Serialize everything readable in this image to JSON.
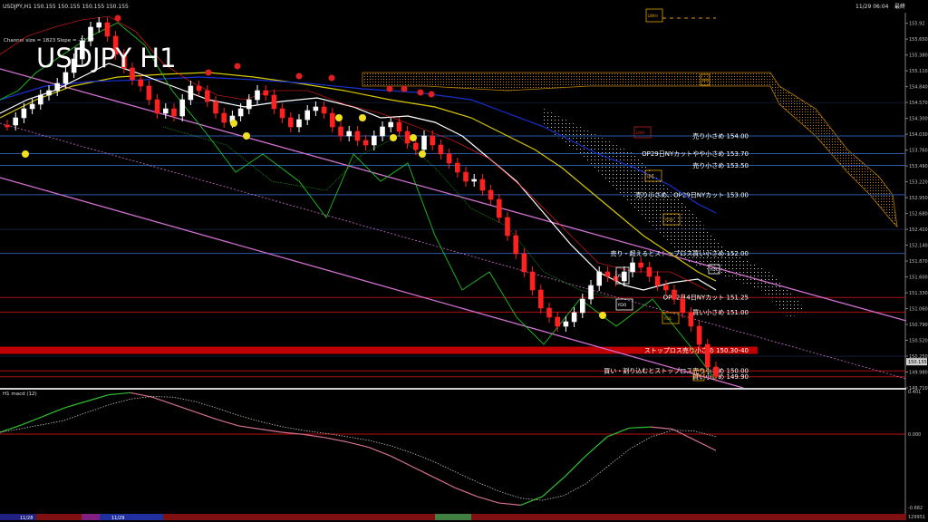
{
  "header": {
    "symbol_line": "USDJPY,H1  150.155 150.155 150.155 150.155",
    "datetime": "11/29 06:04",
    "label_extra": "最終",
    "channel_info": "Channel size = 1823 Slope = -11.27",
    "big_title": "USDJPY H1"
  },
  "macd": {
    "label": "H1  macd (12)",
    "top_value": "0.401",
    "bottom_value": "-0.682",
    "zero_value": "0.000",
    "bottom_corner": "129951"
  },
  "bottom_bar": {
    "date_1": "11/28",
    "date_2": "11/29"
  },
  "colors": {
    "bull": "#ffffff",
    "bear": "#ff2020",
    "kumo": "#c08000",
    "gridline": "#2a58a8",
    "redline": "#b01010",
    "channel": "#d070d0",
    "green": "#20c020",
    "ma_white": "#ffffff",
    "ma_yellow": "#d8c800",
    "ma_blue": "#1830d0"
  },
  "chart_data": {
    "type": "candlestick",
    "symbol": "USDJPY",
    "timeframe": "H1",
    "y_axis_ticks": [
      155.92,
      155.65,
      155.38,
      155.11,
      154.84,
      154.57,
      154.3,
      154.03,
      153.76,
      153.49,
      153.22,
      152.95,
      152.68,
      152.41,
      152.14,
      151.87,
      151.6,
      151.33,
      151.06,
      150.79,
      150.52,
      150.25,
      149.98,
      149.71
    ],
    "price_current": 150.155,
    "ylim": [
      149.71,
      156.1
    ],
    "levels": [
      {
        "price": 154.0,
        "label": "売り小さめ 154.00",
        "kind": "blue"
      },
      {
        "price": 153.7,
        "label": "OP29日NYカットやや小さめ 153.70",
        "kind": "blue"
      },
      {
        "price": 153.5,
        "label": "売り小さめ 153.50",
        "kind": "blue"
      },
      {
        "price": 153.0,
        "label": "売り小さめ、OP29日NYカット 153.00",
        "kind": "blue"
      },
      {
        "price": 152.0,
        "label": "売り・超えるとストップロス買い小さめ 152.00",
        "kind": "blue"
      },
      {
        "price": 151.25,
        "label": "OP12月4日NYカット 151.25",
        "kind": "red"
      },
      {
        "price": 151.0,
        "label": "買い小さめ 151.00",
        "kind": "red"
      },
      {
        "price": 150.35,
        "label": "ストップロス売り小さめ 150.30-40",
        "kind": "band"
      },
      {
        "price": 150.0,
        "label": "買い・割り込むとストップロス売り小さめ 150.00",
        "kind": "red"
      },
      {
        "price": 149.9,
        "label": "買い小さめ 149.90",
        "kind": "red"
      }
    ],
    "box_labels": [
      "LWIH",
      "LWH",
      "WH",
      "LWL",
      "YDH",
      "YDC",
      "YDO",
      "YDL",
      "DW",
      "YDC"
    ],
    "macd_series": [
      0.02,
      0.09,
      0.17,
      0.25,
      0.31,
      0.37,
      0.39,
      0.35,
      0.28,
      0.21,
      0.14,
      0.08,
      0.05,
      0.02,
      0.0,
      -0.03,
      -0.07,
      -0.12,
      -0.2,
      -0.3,
      -0.4,
      -0.5,
      -0.58,
      -0.64,
      -0.66,
      -0.58,
      -0.4,
      -0.2,
      -0.02,
      0.06,
      0.07,
      0.05,
      -0.05,
      -0.15
    ]
  }
}
